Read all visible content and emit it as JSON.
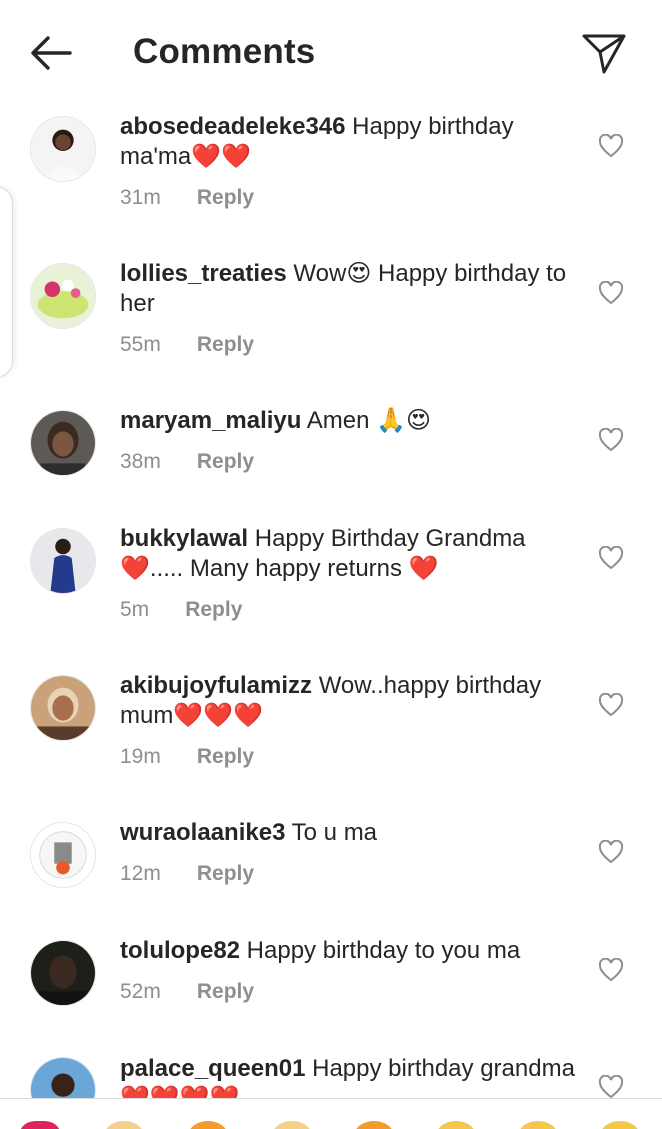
{
  "header": {
    "title": "Comments",
    "back_icon": "arrow-left-icon",
    "share_icon": "paper-plane-icon"
  },
  "comments": [
    {
      "username": "abosedeadeleke346",
      "text": " Happy birthday ma'ma❤️❤️",
      "time": "31m",
      "reply": "Reply"
    },
    {
      "username": "lollies_treaties",
      "text": " Wow😍 Happy birthday to her",
      "time": "55m",
      "reply": "Reply"
    },
    {
      "username": "maryam_maliyu",
      "text": " Amen 🙏😍",
      "time": "38m",
      "reply": "Reply"
    },
    {
      "username": "bukkylawal",
      "text": " Happy Birthday Grandma ❤️..... Many happy returns ❤️",
      "time": "5m",
      "reply": "Reply"
    },
    {
      "username": "akibujoyfulamizz",
      "text": " Wow..happy birthday mum❤️❤️❤️",
      "time": "19m",
      "reply": "Reply"
    },
    {
      "username": "wuraolaanike3",
      "text": " To u ma",
      "time": "12m",
      "reply": "Reply"
    },
    {
      "username": "tolulope82",
      "text": " Happy birthday to you ma",
      "time": "52m",
      "reply": "Reply"
    },
    {
      "username": "palace_queen01",
      "text": " Happy birthday grandma❤️❤️❤️❤️",
      "time": "",
      "reply": ""
    }
  ],
  "icons": {
    "like": "heart-outline-icon"
  },
  "colors": {
    "text": "#262626",
    "meta": "#8e8e8e",
    "like_stroke": "#8e8e8e"
  }
}
